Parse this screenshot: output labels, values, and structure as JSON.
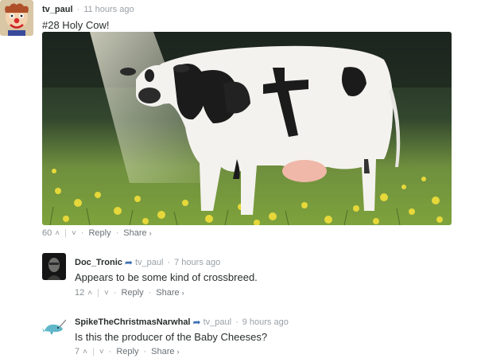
{
  "comments": [
    {
      "author": "tv_paul",
      "time": "11 hours ago",
      "text": "#28 Holy Cow!",
      "upvotes": "60",
      "reply_label": "Reply",
      "share_label": "Share"
    },
    {
      "author": "Doc_Tronic",
      "reply_to": "tv_paul",
      "time": "7 hours ago",
      "text": "Appears to be some kind of crossbreed.",
      "upvotes": "12",
      "reply_label": "Reply",
      "share_label": "Share"
    },
    {
      "author": "SpikeTheChristmasNarwhal",
      "reply_to": "tv_paul",
      "time": "9 hours ago",
      "text": "Is this the producer of the Baby Cheeses?",
      "upvotes": "7",
      "reply_label": "Reply",
      "share_label": "Share"
    }
  ],
  "icons": {
    "upvote": "upvote-icon",
    "downvote": "downvote-icon",
    "reply_arrow": "reply-arrow-icon",
    "share_chevron": "chevron-right-icon"
  },
  "colors": {
    "text": "#2a2e2e",
    "muted": "#9aa0a6",
    "link_blue": "#3d6fb4"
  }
}
